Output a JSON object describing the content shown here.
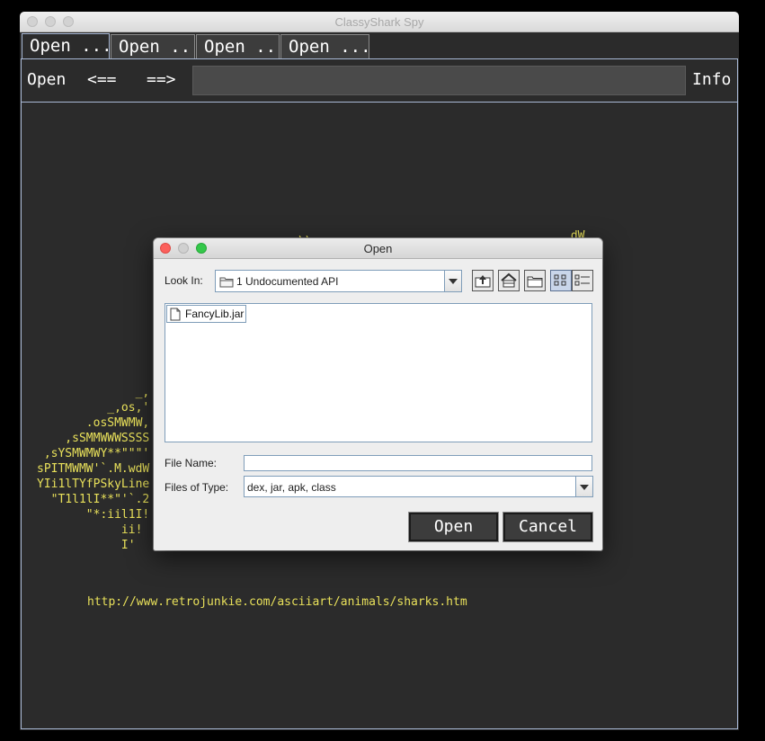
{
  "app": {
    "title": "ClassyShark Spy"
  },
  "tabs": [
    {
      "label": "Open ..."
    },
    {
      "label": "Open ..."
    },
    {
      "label": "Open ..."
    },
    {
      "label": "Open ..."
    }
  ],
  "toolbar": {
    "open_label": "Open",
    "back_label": "<==",
    "forward_label": "==>",
    "info_label": "Info",
    "search_value": ""
  },
  "ascii_art": {
    "top_fragment_1": "\\\\",
    "top_fragment_2": ".dW",
    "lines": [
      "              _,",
      "          _,os,'",
      "       .osSMWMW,",
      "    ,sSMMWWWSSSS",
      " ,sYSMWMWY**\"\"\"'",
      "sPITMWMW'`.M.wdW",
      "YIi1lTYfPSkyLine",
      "  \"T1l1lI**\"'`.2",
      "       \"*:iil1I!",
      "            ii!",
      "            I'"
    ],
    "credit_url": "http://www.retrojunkie.com/asciiart/animals/sharks.htm"
  },
  "dialog": {
    "title": "Open",
    "look_in_label": "Look In:",
    "look_in_value": "1 Undocumented API",
    "files": [
      "FancyLib.jar"
    ],
    "file_name_label": "File Name:",
    "file_name_value": "",
    "files_of_type_label": "Files of Type:",
    "files_of_type_value": "dex, jar, apk, class",
    "open_button": "Open",
    "cancel_button": "Cancel"
  },
  "colors": {
    "background": "#2b2b2b",
    "ascii_text": "#e8e05a",
    "border_accent": "#a9b9d6",
    "dialog_background": "#eeeeee",
    "close_light": "#fc605c",
    "minimize_light": "#d0d0d0",
    "zoom_light": "#34c84a"
  },
  "icons": {
    "folder": "folder-icon",
    "up_folder": "up-one-level-icon",
    "home": "home-icon",
    "new_folder": "new-folder-icon",
    "list_view": "list-view-icon",
    "details_view": "details-view-icon",
    "file": "file-icon"
  }
}
